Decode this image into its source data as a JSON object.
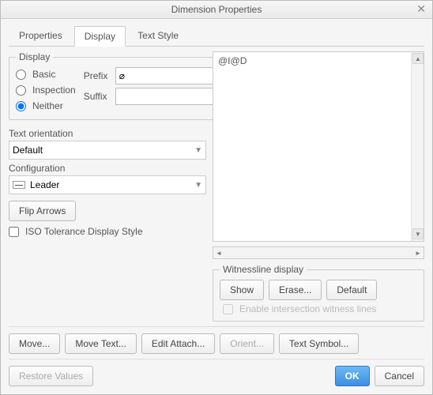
{
  "window": {
    "title": "Dimension Properties"
  },
  "tabs": [
    {
      "label": "Properties",
      "active": false
    },
    {
      "label": "Display",
      "active": true
    },
    {
      "label": "Text Style",
      "active": false
    }
  ],
  "display_group": {
    "legend": "Display",
    "radios": {
      "basic": "Basic",
      "inspection": "Inspection",
      "neither": "Neither",
      "selected": "neither"
    },
    "prefix_label": "Prefix",
    "suffix_label": "Suffix",
    "prefix_value": "⌀",
    "suffix_value": ""
  },
  "text_orientation": {
    "label": "Text orientation",
    "value": "Default"
  },
  "configuration": {
    "label": "Configuration",
    "value": "Leader"
  },
  "flip_arrows_label": "Flip Arrows",
  "iso_checkbox": {
    "label": "ISO Tolerance Display Style",
    "checked": false
  },
  "preview_text": "@I@D",
  "witness": {
    "legend": "Witnessline display",
    "show": "Show",
    "erase": "Erase...",
    "default": "Default",
    "enable_label": "Enable intersection witness lines",
    "enable_checked": false
  },
  "footer_buttons": {
    "move": "Move...",
    "move_text": "Move Text...",
    "edit_attach": "Edit Attach...",
    "orient": "Orient...",
    "text_symbol": "Text Symbol..."
  },
  "bottom": {
    "restore": "Restore Values",
    "ok": "OK",
    "cancel": "Cancel"
  }
}
